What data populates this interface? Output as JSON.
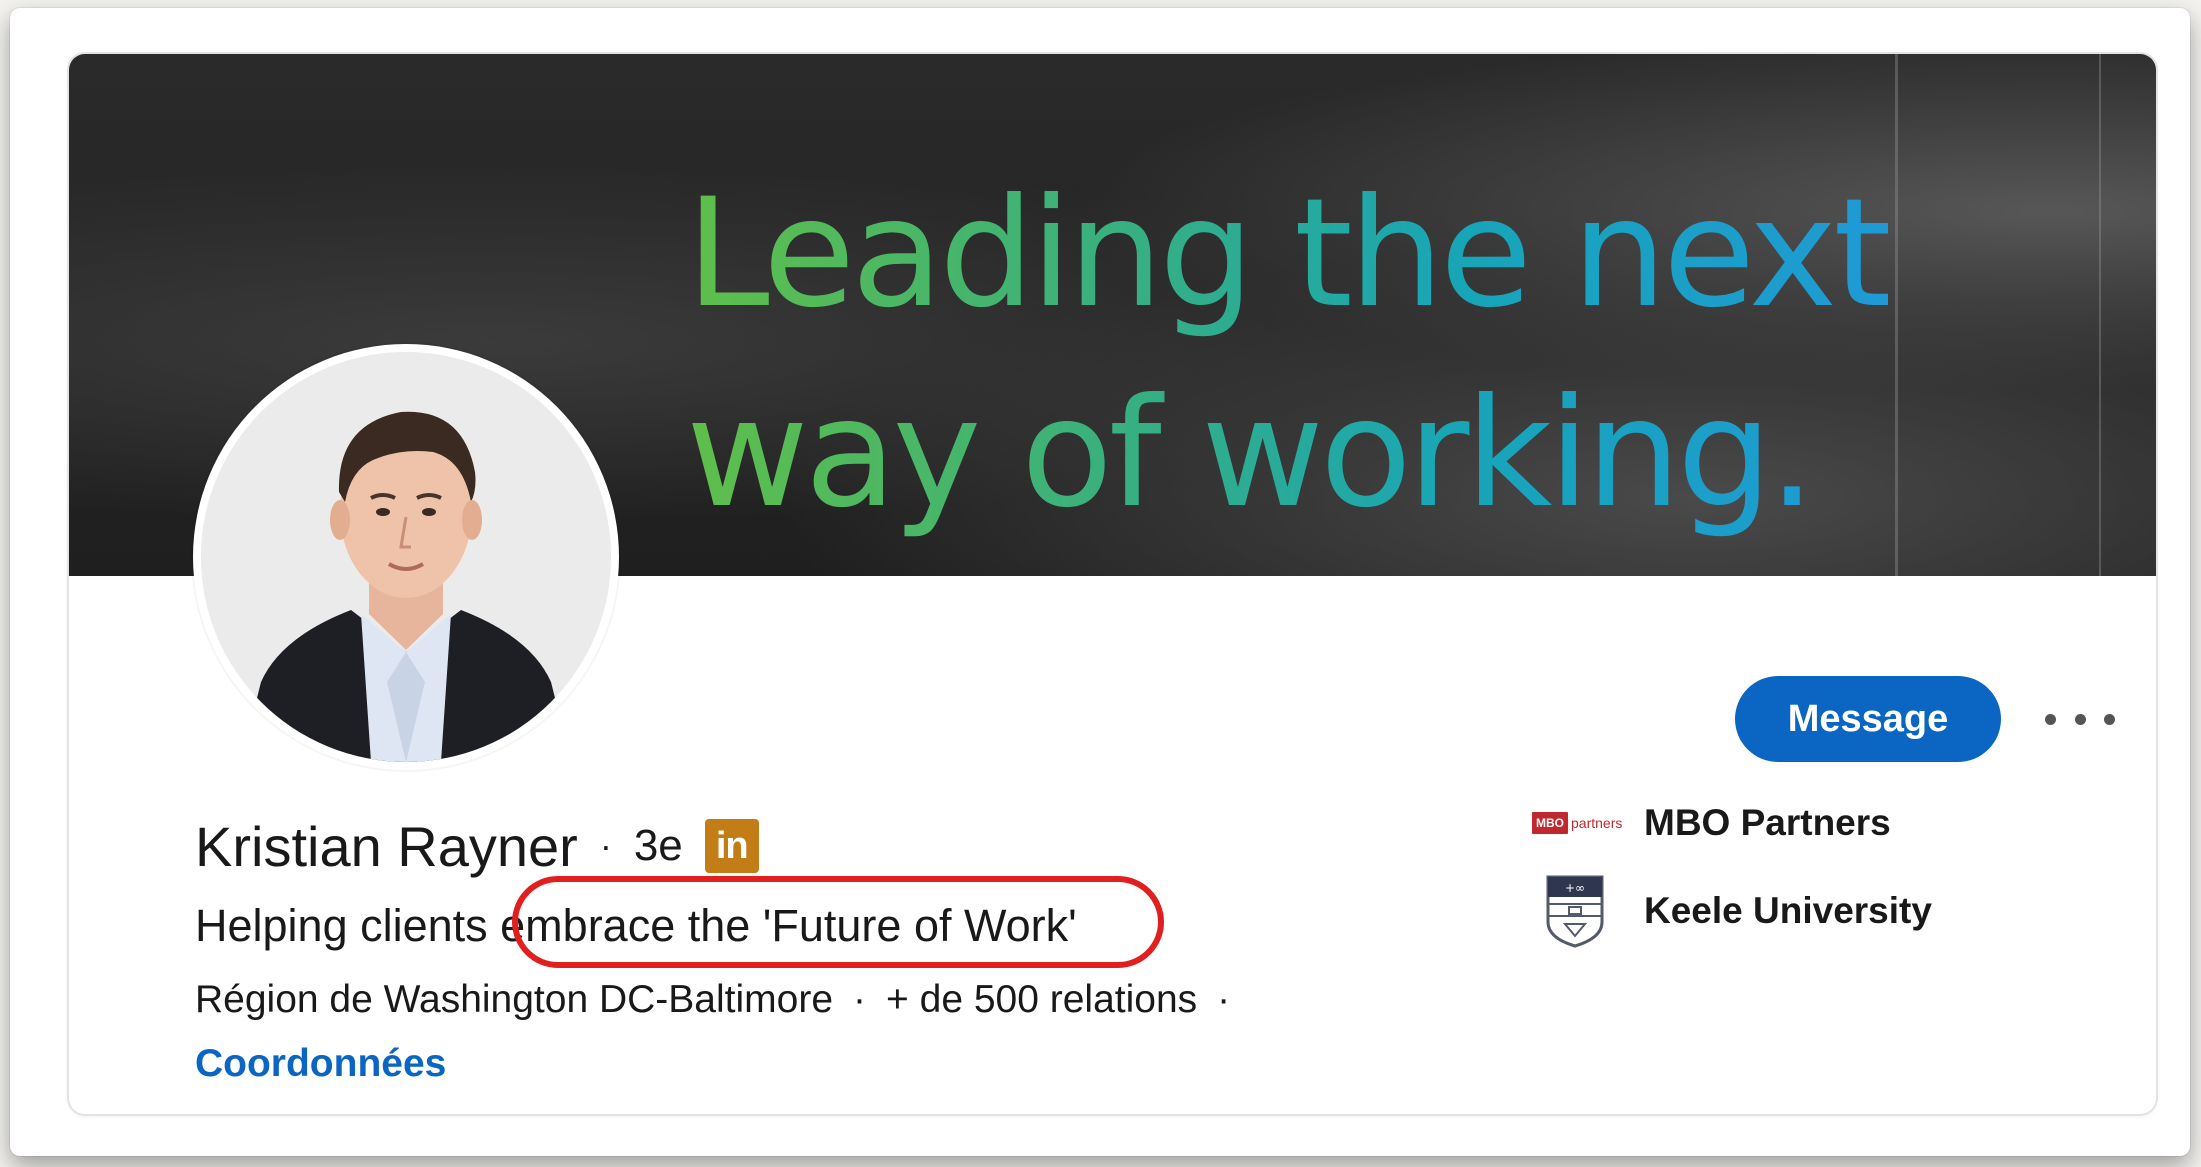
{
  "cover": {
    "headline_line1": "Leading the next",
    "headline_line2": "way of working."
  },
  "profile": {
    "name": "Kristian Rayner",
    "separator": "·",
    "degree": "3e",
    "badge_icon": "linkedin-in-icon",
    "badge_text": "in",
    "headline": "Helping clients embrace the 'Future of Work'",
    "location": "Région de Washington DC-Baltimore",
    "connections": "+ de 500 relations",
    "contact_label": "Coordonnées"
  },
  "actions": {
    "message_label": "Message",
    "more_icon": "ellipsis-icon"
  },
  "organizations": [
    {
      "name": "MBO Partners",
      "logo_box": "MBO",
      "logo_word": "partners",
      "icon": "mbo-partners-logo"
    },
    {
      "name": "Keele University",
      "icon": "keele-university-crest"
    }
  ],
  "colors": {
    "primary_blue": "#0a66c2",
    "linkedin_badge": "#c37d16",
    "annotation_red": "#e21f1f",
    "banner_gradient": [
      "#5fbf4a",
      "#39b07e",
      "#17a5b8",
      "#1f9ad6"
    ]
  }
}
